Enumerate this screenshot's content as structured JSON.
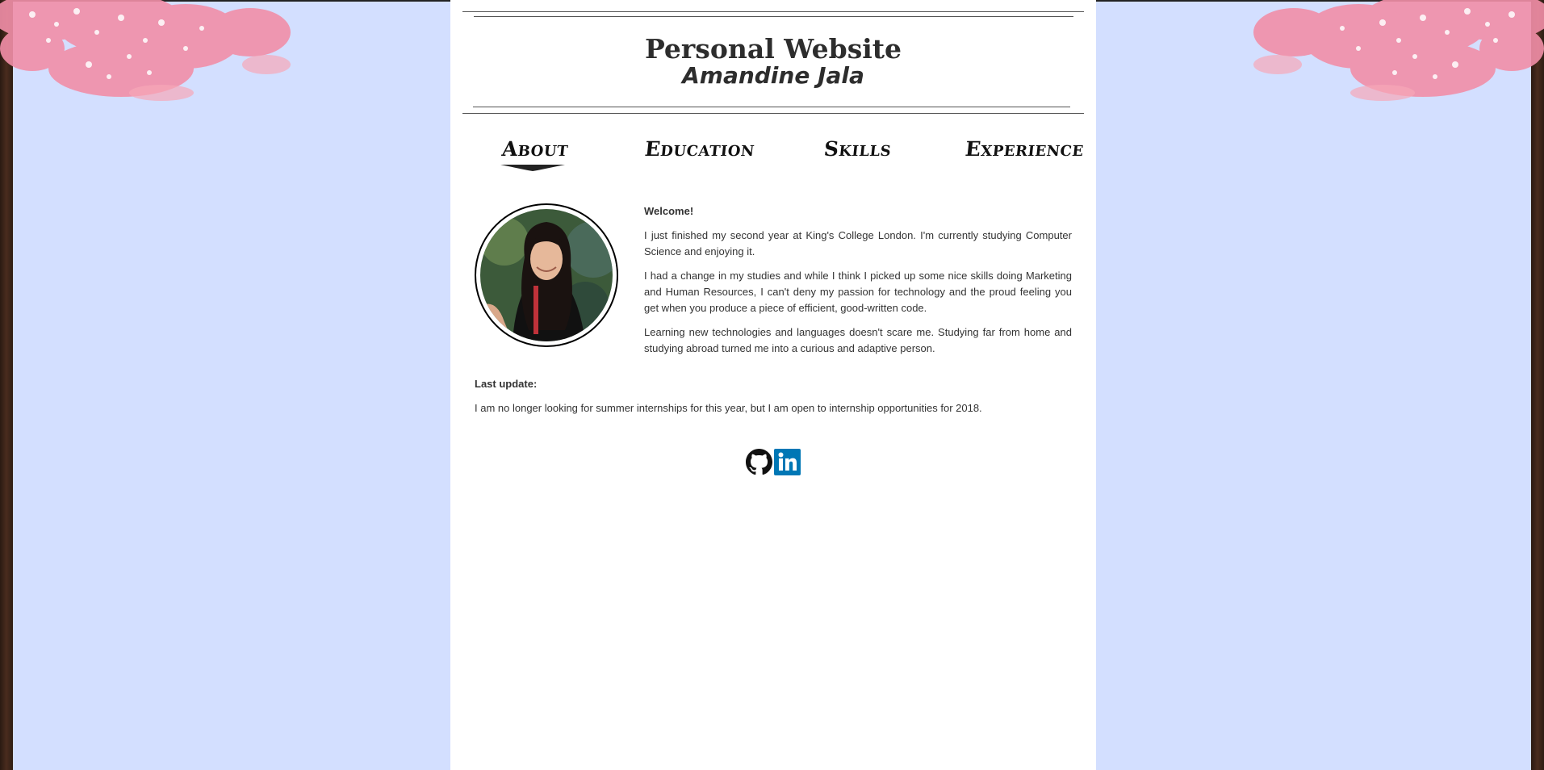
{
  "header": {
    "title": "Personal Website",
    "subtitle": "Amandine Jala"
  },
  "nav": {
    "items": [
      {
        "label": "About",
        "active": true
      },
      {
        "label": "Education",
        "active": false
      },
      {
        "label": "Skills",
        "active": false
      },
      {
        "label": "Experience",
        "active": false
      }
    ]
  },
  "about": {
    "welcome": "Welcome!",
    "paragraphs": [
      "I just finished my second year at King's College London. I'm currently studying Computer Science and enjoying it.",
      "I had a change in my studies and while I think I picked up some nice skills doing Marketing and Human Resources, I can't deny my passion for technology and the proud feeling you get when you produce a piece of efficient, good-written code.",
      "Learning new technologies and languages doesn't scare me. Studying far from home and studying abroad turned me into a curious and adaptive person."
    ]
  },
  "update": {
    "label": "Last update:",
    "text": "I am no longer looking for summer internships for this year, but I am open to internship opportunities for 2018."
  },
  "social": {
    "github_icon": "github-icon",
    "linkedin_icon": "linkedin-icon"
  },
  "colors": {
    "background": "#d3dfff",
    "page": "#ffffff",
    "text": "#333333",
    "linkedin": "#0077b5",
    "blossom": "#f28fa8",
    "trunk": "#3b2418"
  }
}
